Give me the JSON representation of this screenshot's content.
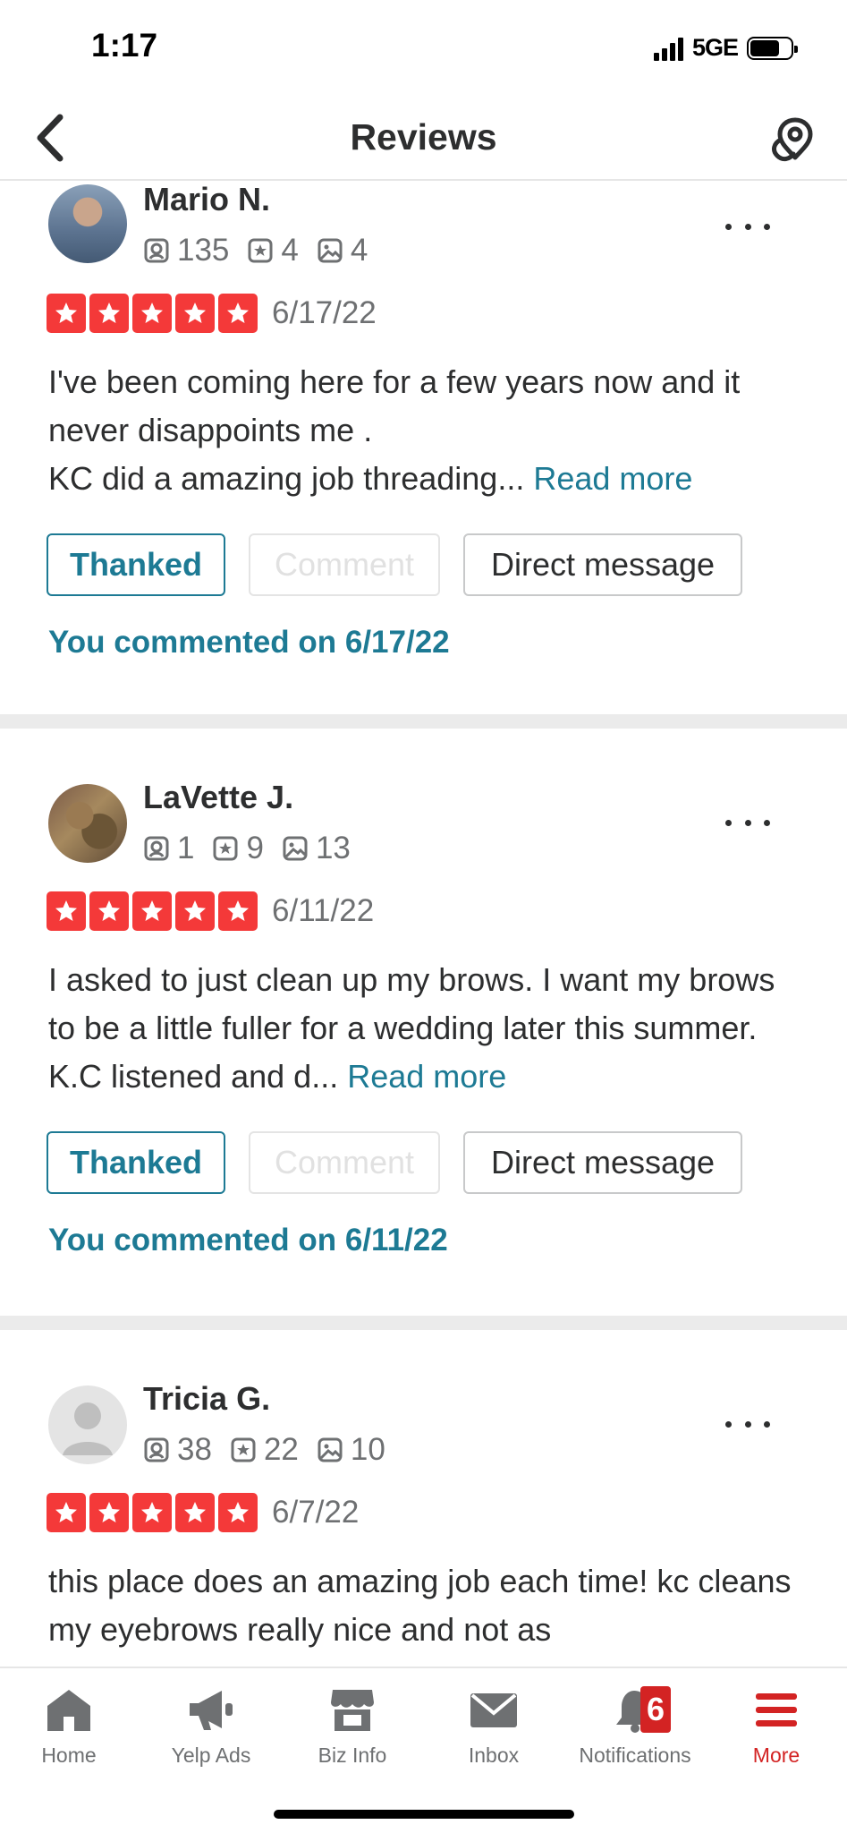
{
  "status_bar": {
    "time": "1:17",
    "network": "5GE"
  },
  "header": {
    "title": "Reviews"
  },
  "reviews": [
    {
      "name": "Mario N.",
      "reviews_count": "135",
      "friends_count": "4",
      "photos_count": "4",
      "rating": 5,
      "date": "6/17/22",
      "text": "I've been coming here for a few years now and it never disappoints me .\nKC did a amazing job threading...",
      "read_more": "Read more",
      "thanked_label": "Thanked",
      "comment_label": "Comment",
      "dm_label": "Direct message",
      "commented_text": "You commented on 6/17/22"
    },
    {
      "name": "LaVette J.",
      "reviews_count": "1",
      "friends_count": "9",
      "photos_count": "13",
      "rating": 5,
      "date": "6/11/22",
      "text": "I asked to just clean up my brows. I want my brows to be a little fuller for a wedding later this summer. K.C listened and d...",
      "read_more": "Read more",
      "thanked_label": "Thanked",
      "comment_label": "Comment",
      "dm_label": "Direct message",
      "commented_text": "You commented on 6/11/22"
    },
    {
      "name": "Tricia G.",
      "reviews_count": "38",
      "friends_count": "22",
      "photos_count": "10",
      "rating": 5,
      "date": "6/7/22",
      "text": "this place does an amazing job each time! kc cleans my eyebrows really nice and not as"
    }
  ],
  "tabbar": {
    "items": [
      {
        "label": "Home",
        "icon": "home-icon"
      },
      {
        "label": "Yelp Ads",
        "icon": "megaphone-icon"
      },
      {
        "label": "Biz Info",
        "icon": "storefront-icon"
      },
      {
        "label": "Inbox",
        "icon": "envelope-icon"
      },
      {
        "label": "Notifications",
        "icon": "bell-icon",
        "badge": "6"
      },
      {
        "label": "More",
        "icon": "menu-icon"
      }
    ],
    "active": "More"
  },
  "colors": {
    "star_red": "#f43939",
    "link_teal": "#1d7a94",
    "brand_red": "#d32323",
    "text_dark": "#2d2e2f",
    "text_gray": "#6e7072"
  }
}
